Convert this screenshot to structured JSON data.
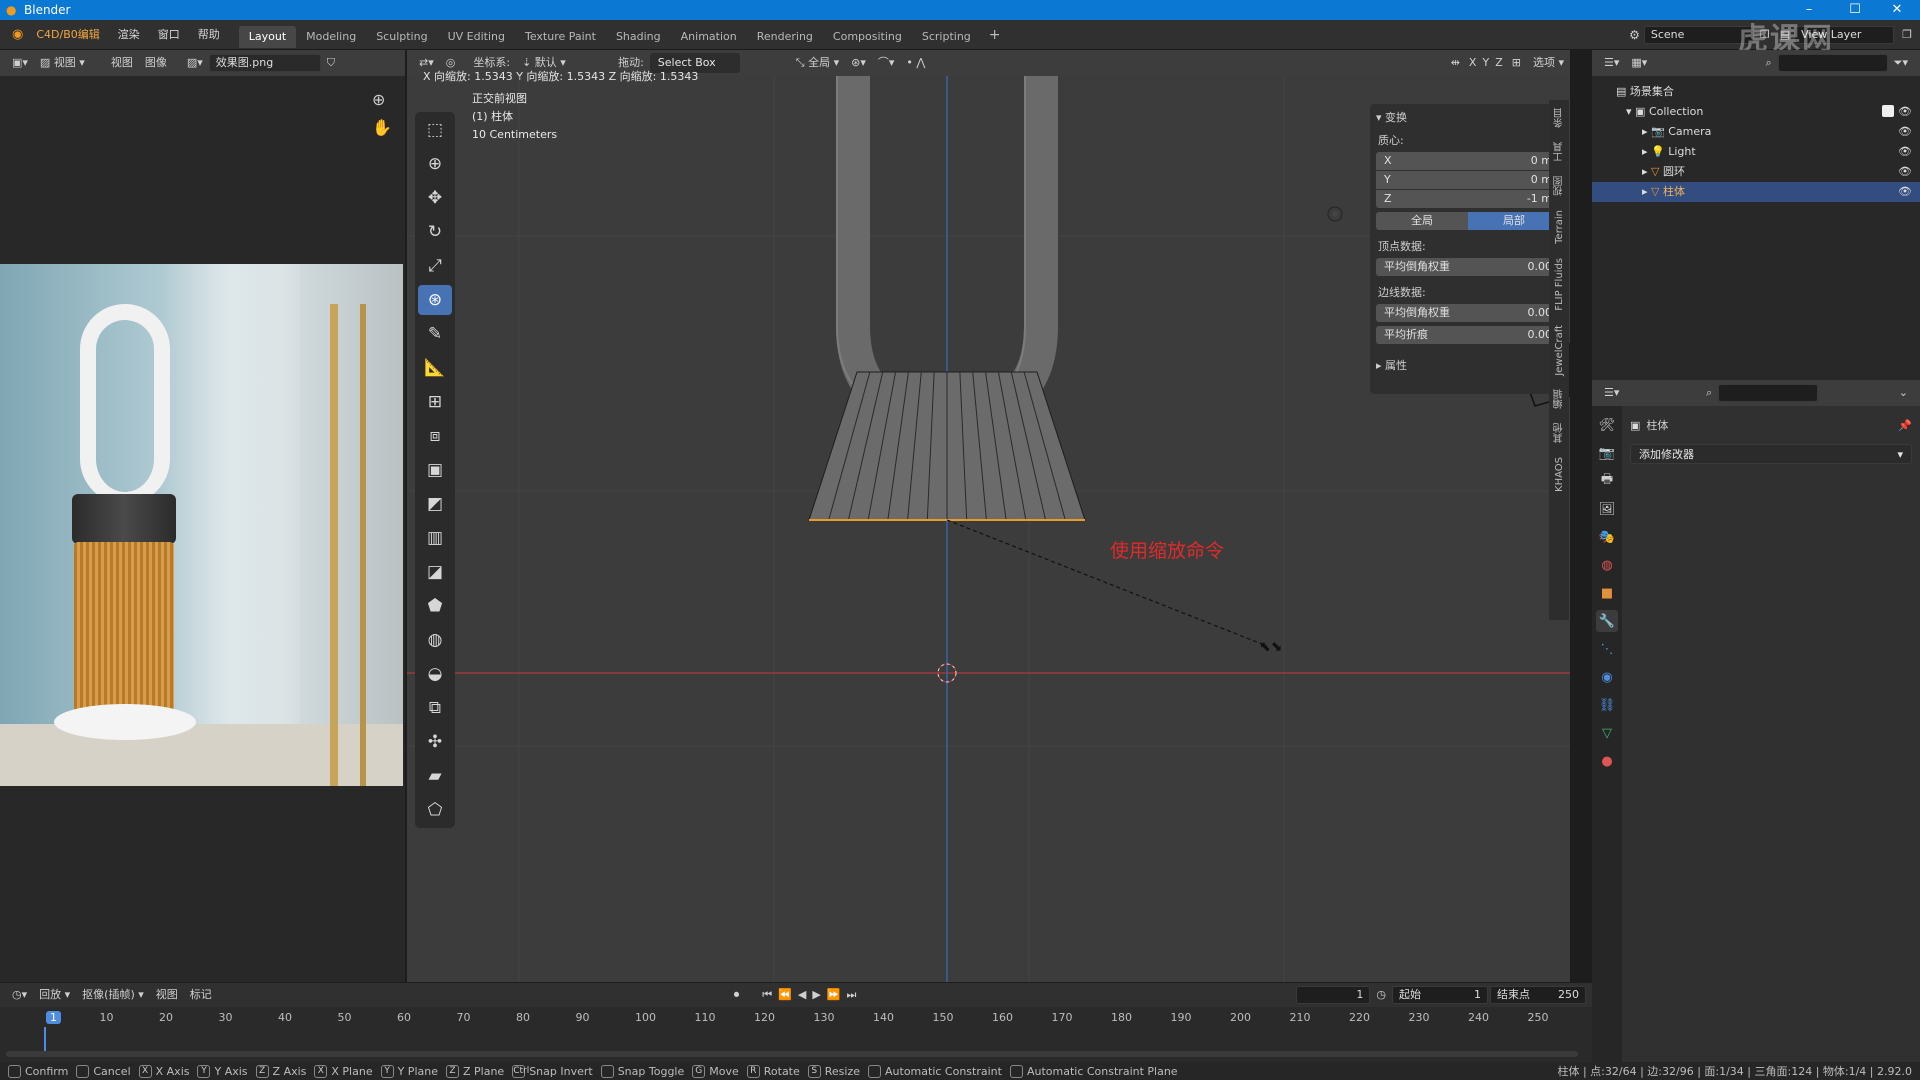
{
  "app": {
    "window_title": "Blender",
    "watermark": "虎课网"
  },
  "top_menu": {
    "items": [
      "C4D/B0编辑",
      "渲染",
      "窗口",
      "帮助"
    ],
    "workspaces": [
      "Layout",
      "Modeling",
      "Sculpting",
      "UV Editing",
      "Texture Paint",
      "Shading",
      "Animation",
      "Rendering",
      "Compositing",
      "Scripting"
    ],
    "active_workspace": "Layout",
    "scene": "Scene",
    "view_layer": "View Layer"
  },
  "image_editor": {
    "view_menu": "视图",
    "menus": [
      "视图",
      "图像"
    ],
    "image_name": "效果图.png"
  },
  "viewport_header": {
    "coord_label": "坐标系:",
    "coord_value": "默认",
    "drag_label": "拖动:",
    "drag_value": "Select Box",
    "pivot": "全局",
    "axes": [
      "X",
      "Y",
      "Z"
    ],
    "options": "选项"
  },
  "viewport": {
    "scale_readout": "X 向缩放: 1.5343  Y 向缩放: 1.5343  Z 向缩放: 1.5343",
    "view_name": "正交前视图",
    "object_line": "(1) 柱体",
    "unit_line": "10 Centimeters",
    "annotation": "使用缩放命令",
    "colors": {
      "x_axis": "#b33a3a",
      "z_axis": "#3a6ab3",
      "annotation": "#e02a2a",
      "selected_edge": "#e69b2a"
    }
  },
  "npanel": {
    "transform_title": "变换",
    "median_label": "质心:",
    "fields": [
      {
        "axis": "X",
        "value": "0 m"
      },
      {
        "axis": "Y",
        "value": "0 m"
      },
      {
        "axis": "Z",
        "value": "-1 m"
      }
    ],
    "toggle": [
      "全局",
      "局部"
    ],
    "vertex_data_label": "顶点数据:",
    "vertex_bevel": {
      "label": "平均倒角权重",
      "value": "0.00"
    },
    "edge_data_label": "边线数据:",
    "edge_bevel": {
      "label": "平均倒角权重",
      "value": "0.00"
    },
    "edge_crease": {
      "label": "平均折痕",
      "value": "0.00"
    },
    "properties_title": "属性",
    "tabs": [
      "条目",
      "工具",
      "视图",
      "Terrain",
      "FLIP Fluids",
      "JewelCraft",
      "编辑",
      "其他",
      "KHAOS"
    ]
  },
  "outliner": {
    "root": "场景集合",
    "items": [
      {
        "name": "Collection"
      },
      {
        "name": "Camera"
      },
      {
        "name": "Light"
      },
      {
        "name": "圆环"
      },
      {
        "name": "柱体"
      }
    ]
  },
  "properties": {
    "object_name": "柱体",
    "add_modifier": "添加修改器"
  },
  "timeline": {
    "menus": [
      "回放",
      "抠像(插帧)",
      "视图",
      "标记"
    ],
    "current_frame": "1",
    "start_label": "起始",
    "start": "1",
    "end_label": "结束点",
    "end": "250",
    "ticks": [
      "1",
      "10",
      "20",
      "30",
      "40",
      "50",
      "60",
      "70",
      "80",
      "90",
      "100",
      "110",
      "120",
      "130",
      "140",
      "150",
      "160",
      "170",
      "180",
      "190",
      "200",
      "210",
      "220",
      "230",
      "240",
      "250"
    ]
  },
  "statusbar": {
    "hints": [
      {
        "key": "",
        "label": "Confirm"
      },
      {
        "key": "",
        "label": "Cancel"
      },
      {
        "key": "X",
        "label": "X Axis"
      },
      {
        "key": "Y",
        "label": "Y Axis"
      },
      {
        "key": "Z",
        "label": "Z Axis"
      },
      {
        "key": "X",
        "label": "X Plane"
      },
      {
        "key": "Y",
        "label": "Y Plane"
      },
      {
        "key": "Z",
        "label": "Z Plane"
      },
      {
        "key": "Ctrl",
        "label": "Snap Invert"
      },
      {
        "key": "",
        "label": "Snap Toggle"
      },
      {
        "key": "G",
        "label": "Move"
      },
      {
        "key": "R",
        "label": "Rotate"
      },
      {
        "key": "S",
        "label": "Resize"
      },
      {
        "key": "",
        "label": "Automatic Constraint"
      },
      {
        "key": "",
        "label": "Automatic Constraint Plane"
      }
    ],
    "stats": "柱体 | 点:32/64 | 边:32/96 | 面:1/34 | 三角面:124 | 物体:1/4 | 2.92.0"
  }
}
